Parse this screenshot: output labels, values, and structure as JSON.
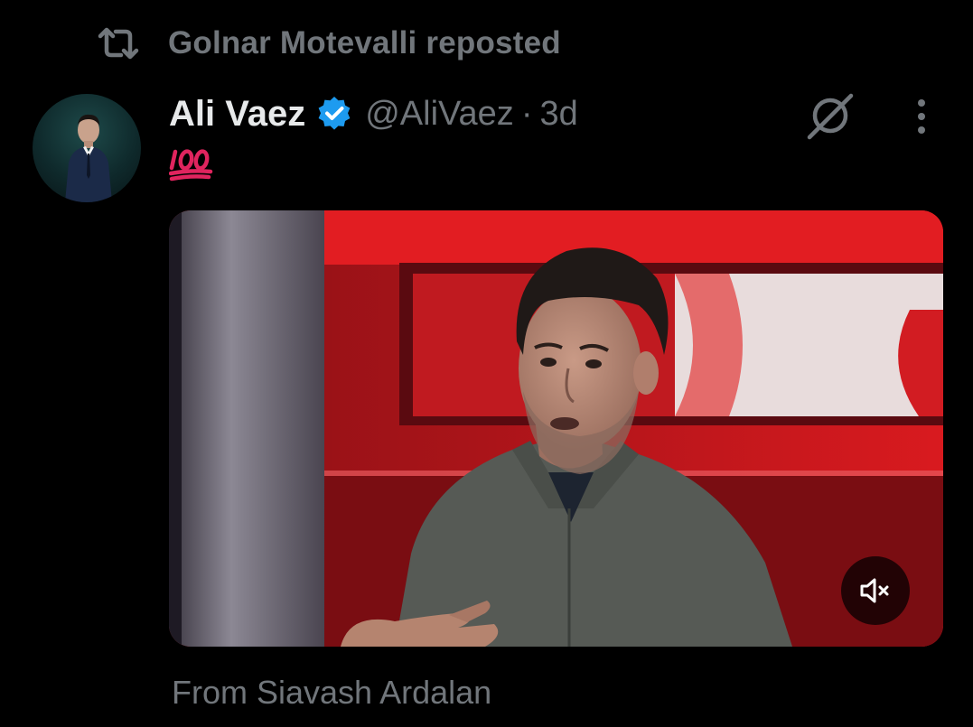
{
  "repost": {
    "icon": "repost-icon",
    "text": "Golnar Motevalli reposted"
  },
  "tweet": {
    "author": {
      "display_name": "Ali Vaez",
      "handle": "@AliVaez",
      "verified": true,
      "avatar": "avatar"
    },
    "separator": "·",
    "time": "3d",
    "text_emoji": "hundred-points-emoji",
    "media": {
      "type": "video",
      "muted": true,
      "mute_icon": "speaker-muted-icon"
    },
    "attribution": "From Siavash Ardalan"
  },
  "actions": {
    "grok_icon": "grok-icon",
    "more_icon": "more-vertical-icon"
  },
  "colors": {
    "background": "#000000",
    "primary_text": "#e7e9ea",
    "secondary_text": "#71767b",
    "verified_blue": "#1d9bf0",
    "emoji_red": "#e0245e"
  }
}
